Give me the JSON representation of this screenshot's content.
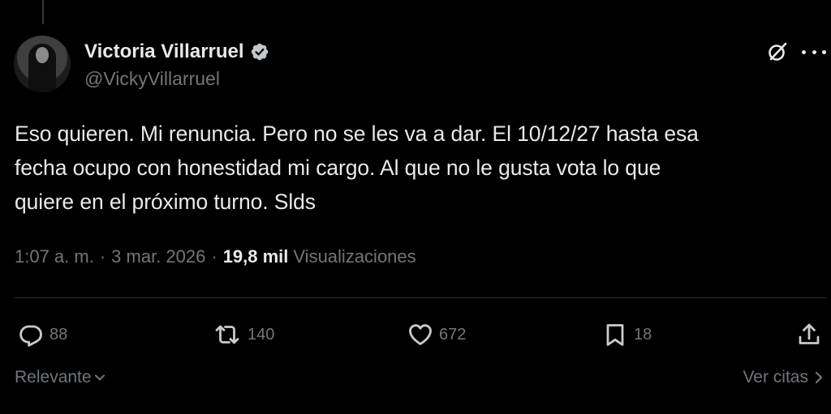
{
  "author": {
    "display_name": "Victoria Villarruel",
    "handle": "@VickyVillarruel",
    "verified": true,
    "verified_color": "#c2c7cc",
    "avatar_icon": "profile-photo"
  },
  "header_icons": {
    "grok": "grok-icon",
    "more": "more-options-icon"
  },
  "tweet": {
    "text": "Eso quieren. Mi renuncia. Pero no se les va a dar. El 10/12/27 hasta esa\nfecha ocupo con honestidad mi cargo. Al que no le gusta vota lo que\nquiere en el próximo turno. Slds"
  },
  "meta": {
    "time": "1:07 a. m.",
    "separator": "·",
    "date": "3 mar. 2026",
    "views_count": "19,8 mil",
    "views_label": "Visualizaciones"
  },
  "actions": {
    "replies": "88",
    "reposts": "140",
    "likes": "672",
    "bookmarks": "18"
  },
  "footer": {
    "sort_label": "Relevante",
    "quotes_label": "Ver citas"
  },
  "colors": {
    "background": "#000000",
    "primary_text": "#e7e9ea",
    "secondary_text": "#71767b",
    "divider": "#2f3336"
  }
}
